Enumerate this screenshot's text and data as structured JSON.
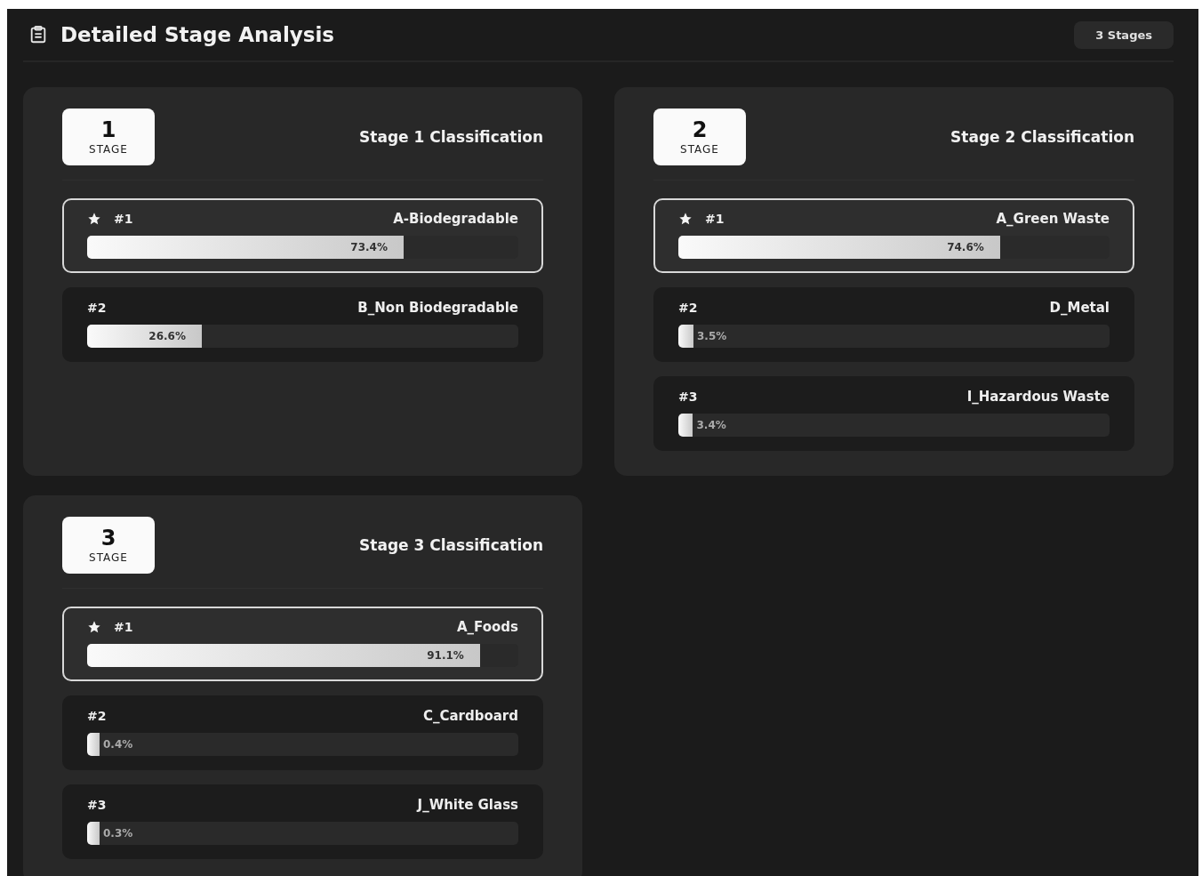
{
  "header": {
    "title": "Detailed Stage Analysis",
    "badge": "3 Stages"
  },
  "stages": [
    {
      "number": "1",
      "number_label": "STAGE",
      "title": "Stage 1 Classification",
      "results": [
        {
          "rank": "#1",
          "name": "A-Biodegradable",
          "percent": "73.4%",
          "level": 0.734,
          "highlighted": true
        },
        {
          "rank": "#2",
          "name": "B_Non Biodegradable",
          "percent": "26.6%",
          "level": 0.266,
          "highlighted": false
        }
      ]
    },
    {
      "number": "2",
      "number_label": "STAGE",
      "title": "Stage 2 Classification",
      "results": [
        {
          "rank": "#1",
          "name": "A_Green Waste",
          "percent": "74.6%",
          "level": 0.746,
          "highlighted": true
        },
        {
          "rank": "#2",
          "name": "D_Metal",
          "percent": "3.5%",
          "level": 0.035,
          "highlighted": false
        },
        {
          "rank": "#3",
          "name": "I_Hazardous Waste",
          "percent": "3.4%",
          "level": 0.034,
          "highlighted": false
        }
      ]
    },
    {
      "number": "3",
      "number_label": "STAGE",
      "title": "Stage 3 Classification",
      "results": [
        {
          "rank": "#1",
          "name": "A_Foods",
          "percent": "91.1%",
          "level": 0.911,
          "highlighted": true
        },
        {
          "rank": "#2",
          "name": "C_Cardboard",
          "percent": "0.4%",
          "level": 0.004,
          "highlighted": false
        },
        {
          "rank": "#3",
          "name": "J_White Glass",
          "percent": "0.3%",
          "level": 0.003,
          "highlighted": false
        }
      ]
    }
  ]
}
